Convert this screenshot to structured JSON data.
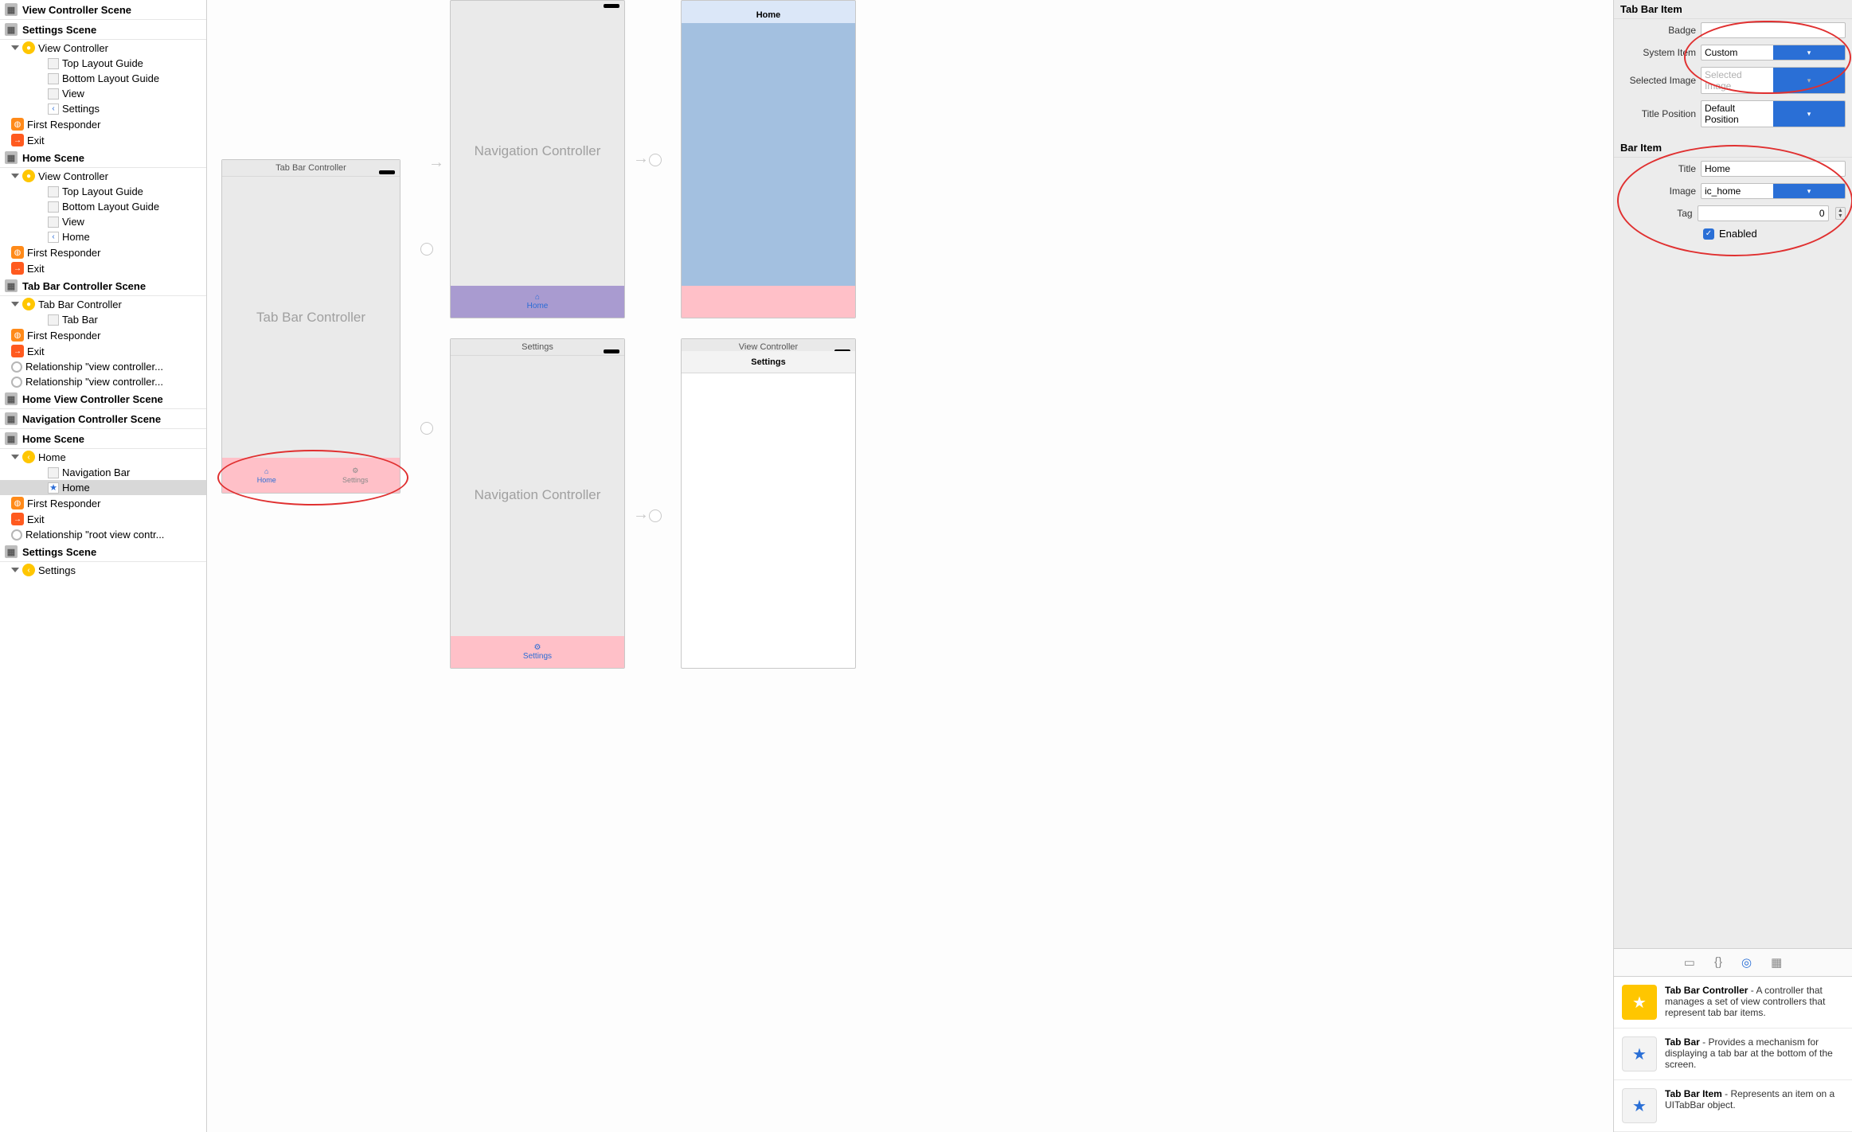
{
  "outline": {
    "scenes": [
      {
        "title": "View Controller Scene",
        "children": []
      },
      {
        "title": "Settings Scene",
        "children": [
          {
            "label": "View Controller",
            "icon": "vc",
            "children": [
              {
                "label": "Top Layout Guide",
                "icon": "sq"
              },
              {
                "label": "Bottom Layout Guide",
                "icon": "sq"
              },
              {
                "label": "View",
                "icon": "sq"
              },
              {
                "label": "Settings",
                "icon": "chev"
              }
            ]
          },
          {
            "label": "First Responder",
            "icon": "cube"
          },
          {
            "label": "Exit",
            "icon": "exit"
          }
        ]
      },
      {
        "title": "Home Scene",
        "children": [
          {
            "label": "View Controller",
            "icon": "vc",
            "children": [
              {
                "label": "Top Layout Guide",
                "icon": "sq"
              },
              {
                "label": "Bottom Layout Guide",
                "icon": "sq"
              },
              {
                "label": "View",
                "icon": "sq"
              },
              {
                "label": "Home",
                "icon": "chev"
              }
            ]
          },
          {
            "label": "First Responder",
            "icon": "cube"
          },
          {
            "label": "Exit",
            "icon": "exit"
          }
        ]
      },
      {
        "title": "Tab Bar Controller Scene",
        "children": [
          {
            "label": "Tab Bar Controller",
            "icon": "vc",
            "children": [
              {
                "label": "Tab Bar",
                "icon": "sq"
              }
            ]
          },
          {
            "label": "First Responder",
            "icon": "cube"
          },
          {
            "label": "Exit",
            "icon": "exit"
          },
          {
            "label": "Relationship \"view controller...",
            "icon": "ring"
          },
          {
            "label": "Relationship \"view controller...",
            "icon": "ring"
          }
        ]
      },
      {
        "title": "Home View Controller Scene",
        "children": []
      },
      {
        "title": "Navigation Controller Scene",
        "children": []
      },
      {
        "title": "Home Scene",
        "children": [
          {
            "label": "Home",
            "icon": "vc-left",
            "children": [
              {
                "label": "Navigation Bar",
                "icon": "sq"
              },
              {
                "label": "Home",
                "icon": "star",
                "selected": true
              }
            ]
          },
          {
            "label": "First Responder",
            "icon": "cube"
          },
          {
            "label": "Exit",
            "icon": "exit"
          },
          {
            "label": "Relationship \"root view contr...",
            "icon": "ring"
          }
        ]
      },
      {
        "title": "Settings Scene",
        "children": [
          {
            "label": "Settings",
            "icon": "vc-left",
            "truncated": true
          }
        ]
      }
    ]
  },
  "canvas": {
    "tabbar_title": "Tab Bar Controller",
    "tabbar_body": "Tab Bar Controller",
    "tabs": [
      {
        "label": "Home",
        "icon": "⌂"
      },
      {
        "label": "Settings",
        "icon": "⚙"
      }
    ],
    "nav1_body": "Navigation Controller",
    "nav2_body": "Navigation Controller",
    "nav2_title": "Settings",
    "home_title": "Home",
    "nav1_bot": "Home",
    "nav2_bot": "Settings",
    "vc2_title": "View Controller",
    "vc2_nav": "Settings"
  },
  "inspector": {
    "section1": "Tab Bar Item",
    "badge_label": "Badge",
    "badge_value": "",
    "system_item_label": "System Item",
    "system_item_value": "Custom",
    "selected_image_label": "Selected Image",
    "selected_image_placeholder": "Selected Image",
    "title_position_label": "Title Position",
    "title_position_value": "Default Position",
    "section2": "Bar Item",
    "title_label": "Title",
    "title_value": "Home",
    "image_label": "Image",
    "image_value": "ic_home",
    "tag_label": "Tag",
    "tag_value": "0",
    "enabled_label": "Enabled"
  },
  "library": {
    "items": [
      {
        "title": "Tab Bar Controller",
        "desc": " - A controller that manages a set of view controllers that represent tab bar items.",
        "iconcolor": "yellow",
        "iconchar": "★⋯"
      },
      {
        "title": "Tab Bar",
        "desc": " - Provides a mechanism for displaying a tab bar at the bottom of the screen.",
        "iconcolor": "",
        "iconchar": "★ ⋯"
      },
      {
        "title": "Tab Bar Item",
        "desc": " - Represents an item on a UITabBar object.",
        "iconcolor": "",
        "iconchar": "★"
      }
    ]
  }
}
